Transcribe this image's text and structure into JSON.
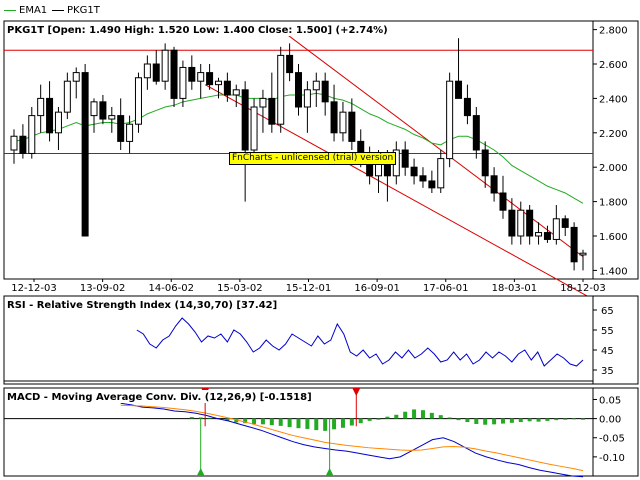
{
  "legend": [
    {
      "label": "EMA1",
      "color": "#22aa22"
    },
    {
      "label": "PKG1T",
      "color": "#000000"
    }
  ],
  "watermark": "FnCharts - unlicensed (trial) version",
  "chart_data": [
    {
      "type": "candlestick",
      "title": "PKG1T [Open: 1.490  High: 1.520  Low: 1.400  Close: 1.500] (+2.74%)",
      "ylim": [
        1.35,
        2.85
      ],
      "yticks": [
        "2.800",
        "2.600",
        "2.400",
        "2.200",
        "2.000",
        "1.800",
        "1.600",
        "1.400"
      ],
      "ytick_values": [
        2.8,
        2.6,
        2.4,
        2.2,
        2.0,
        1.8,
        1.6,
        1.4
      ],
      "xticks": [
        "12-12-03",
        "13-09-02",
        "14-06-02",
        "15-03-02",
        "15-12-01",
        "16-09-01",
        "17-06-01",
        "18-03-01",
        "18-12-03"
      ],
      "horizontal_lines": [
        2.68,
        2.08
      ],
      "candles": [
        {
          "o": 2.1,
          "h": 2.22,
          "l": 2.02,
          "c": 2.18
        },
        {
          "o": 2.18,
          "h": 2.25,
          "l": 2.05,
          "c": 2.08
        },
        {
          "o": 2.08,
          "h": 2.35,
          "l": 2.05,
          "c": 2.3
        },
        {
          "o": 2.3,
          "h": 2.48,
          "l": 2.2,
          "c": 2.4
        },
        {
          "o": 2.4,
          "h": 2.5,
          "l": 2.15,
          "c": 2.2
        },
        {
          "o": 2.2,
          "h": 2.35,
          "l": 2.1,
          "c": 2.32
        },
        {
          "o": 2.32,
          "h": 2.55,
          "l": 2.28,
          "c": 2.5
        },
        {
          "o": 2.5,
          "h": 2.58,
          "l": 2.4,
          "c": 2.55
        },
        {
          "o": 2.55,
          "h": 2.6,
          "l": 1.6,
          "c": 1.6
        },
        {
          "o": 2.3,
          "h": 2.4,
          "l": 2.2,
          "c": 2.38
        },
        {
          "o": 2.38,
          "h": 2.42,
          "l": 2.25,
          "c": 2.28
        },
        {
          "o": 2.28,
          "h": 2.35,
          "l": 2.2,
          "c": 2.3
        },
        {
          "o": 2.3,
          "h": 2.4,
          "l": 2.1,
          "c": 2.15
        },
        {
          "o": 2.15,
          "h": 2.3,
          "l": 2.08,
          "c": 2.25
        },
        {
          "o": 2.25,
          "h": 2.55,
          "l": 2.2,
          "c": 2.52
        },
        {
          "o": 2.52,
          "h": 2.65,
          "l": 2.45,
          "c": 2.6
        },
        {
          "o": 2.6,
          "h": 2.68,
          "l": 2.48,
          "c": 2.5
        },
        {
          "o": 2.5,
          "h": 2.72,
          "l": 2.45,
          "c": 2.68
        },
        {
          "o": 2.68,
          "h": 2.7,
          "l": 2.35,
          "c": 2.4
        },
        {
          "o": 2.4,
          "h": 2.62,
          "l": 2.35,
          "c": 2.58
        },
        {
          "o": 2.58,
          "h": 2.65,
          "l": 2.45,
          "c": 2.5
        },
        {
          "o": 2.5,
          "h": 2.6,
          "l": 2.4,
          "c": 2.55
        },
        {
          "o": 2.55,
          "h": 2.6,
          "l": 2.45,
          "c": 2.48
        },
        {
          "o": 2.48,
          "h": 2.52,
          "l": 2.4,
          "c": 2.5
        },
        {
          "o": 2.5,
          "h": 2.55,
          "l": 2.38,
          "c": 2.42
        },
        {
          "o": 2.42,
          "h": 2.48,
          "l": 2.35,
          "c": 2.45
        },
        {
          "o": 2.45,
          "h": 2.5,
          "l": 1.8,
          "c": 2.1
        },
        {
          "o": 2.1,
          "h": 2.4,
          "l": 2.05,
          "c": 2.35
        },
        {
          "o": 2.35,
          "h": 2.45,
          "l": 2.2,
          "c": 2.4
        },
        {
          "o": 2.4,
          "h": 2.55,
          "l": 2.2,
          "c": 2.25
        },
        {
          "o": 2.25,
          "h": 2.7,
          "l": 2.2,
          "c": 2.65
        },
        {
          "o": 2.65,
          "h": 2.72,
          "l": 2.5,
          "c": 2.55
        },
        {
          "o": 2.55,
          "h": 2.6,
          "l": 2.3,
          "c": 2.35
        },
        {
          "o": 2.35,
          "h": 2.5,
          "l": 2.2,
          "c": 2.45
        },
        {
          "o": 2.45,
          "h": 2.55,
          "l": 2.35,
          "c": 2.5
        },
        {
          "o": 2.5,
          "h": 2.55,
          "l": 2.3,
          "c": 2.38
        },
        {
          "o": 2.38,
          "h": 2.48,
          "l": 2.15,
          "c": 2.2
        },
        {
          "o": 2.2,
          "h": 2.38,
          "l": 2.15,
          "c": 2.32
        },
        {
          "o": 2.32,
          "h": 2.4,
          "l": 2.1,
          "c": 2.15
        },
        {
          "o": 2.15,
          "h": 2.22,
          "l": 2.0,
          "c": 2.05
        },
        {
          "o": 2.05,
          "h": 2.12,
          "l": 1.9,
          "c": 1.95
        },
        {
          "o": 1.95,
          "h": 2.1,
          "l": 1.85,
          "c": 2.05
        },
        {
          "o": 2.05,
          "h": 2.1,
          "l": 1.8,
          "c": 1.95
        },
        {
          "o": 1.95,
          "h": 2.15,
          "l": 1.9,
          "c": 2.1
        },
        {
          "o": 2.1,
          "h": 2.15,
          "l": 1.95,
          "c": 2.0
        },
        {
          "o": 2.0,
          "h": 2.05,
          "l": 1.9,
          "c": 1.95
        },
        {
          "o": 1.95,
          "h": 2.0,
          "l": 1.88,
          "c": 1.92
        },
        {
          "o": 1.92,
          "h": 1.98,
          "l": 1.85,
          "c": 1.88
        },
        {
          "o": 1.88,
          "h": 2.1,
          "l": 1.85,
          "c": 2.05
        },
        {
          "o": 2.05,
          "h": 2.55,
          "l": 2.0,
          "c": 2.5
        },
        {
          "o": 2.5,
          "h": 2.75,
          "l": 2.45,
          "c": 2.4
        },
        {
          "o": 2.4,
          "h": 2.48,
          "l": 2.25,
          "c": 2.3
        },
        {
          "o": 2.3,
          "h": 2.35,
          "l": 2.05,
          "c": 2.1
        },
        {
          "o": 2.1,
          "h": 2.15,
          "l": 1.88,
          "c": 1.95
        },
        {
          "o": 1.95,
          "h": 2.0,
          "l": 1.8,
          "c": 1.85
        },
        {
          "o": 1.85,
          "h": 1.95,
          "l": 1.7,
          "c": 1.75
        },
        {
          "o": 1.75,
          "h": 1.82,
          "l": 1.55,
          "c": 1.6
        },
        {
          "o": 1.6,
          "h": 1.8,
          "l": 1.55,
          "c": 1.75
        },
        {
          "o": 1.75,
          "h": 1.78,
          "l": 1.55,
          "c": 1.6
        },
        {
          "o": 1.6,
          "h": 1.68,
          "l": 1.55,
          "c": 1.62
        },
        {
          "o": 1.62,
          "h": 1.66,
          "l": 1.56,
          "c": 1.58
        },
        {
          "o": 1.58,
          "h": 1.78,
          "l": 1.55,
          "c": 1.7
        },
        {
          "o": 1.7,
          "h": 1.72,
          "l": 1.6,
          "c": 1.65
        },
        {
          "o": 1.65,
          "h": 1.68,
          "l": 1.4,
          "c": 1.45
        },
        {
          "o": 1.49,
          "h": 1.52,
          "l": 1.4,
          "c": 1.5
        }
      ],
      "ema": [
        2.15,
        2.16,
        2.18,
        2.2,
        2.21,
        2.22,
        2.24,
        2.26,
        2.24,
        2.25,
        2.26,
        2.26,
        2.25,
        2.26,
        2.28,
        2.31,
        2.33,
        2.35,
        2.36,
        2.38,
        2.39,
        2.4,
        2.41,
        2.42,
        2.42,
        2.42,
        2.4,
        2.4,
        2.4,
        2.39,
        2.41,
        2.42,
        2.42,
        2.42,
        2.43,
        2.42,
        2.4,
        2.39,
        2.37,
        2.34,
        2.31,
        2.29,
        2.26,
        2.24,
        2.22,
        2.19,
        2.17,
        2.14,
        2.13,
        2.16,
        2.18,
        2.18,
        2.16,
        2.13,
        2.1,
        2.06,
        2.01,
        1.98,
        1.95,
        1.92,
        1.89,
        1.87,
        1.85,
        1.82,
        1.79
      ],
      "trend_channel": {
        "upper": {
          "from": [
            30.5,
            2.78
          ],
          "to": [
            64.0,
            1.48
          ]
        },
        "lower": {
          "from": [
            21.5,
            2.48
          ],
          "to": [
            64.5,
            1.25
          ]
        }
      }
    },
    {
      "type": "line",
      "title": "RSI - Relative Strength Index (14,30,70) [37.42]",
      "ylim": [
        30,
        70
      ],
      "yticks": [
        "65",
        "55",
        "45",
        "35"
      ],
      "ytick_values": [
        65,
        55,
        45,
        35
      ],
      "series": [
        {
          "name": "RSI",
          "color": "#0000cc",
          "values": [
            null,
            null,
            null,
            null,
            null,
            null,
            null,
            null,
            null,
            null,
            null,
            null,
            null,
            null,
            null,
            null,
            null,
            null,
            null,
            55,
            53,
            48,
            46,
            50,
            52,
            57,
            61,
            58,
            54,
            49,
            52,
            51,
            53,
            49,
            55,
            53,
            49,
            44,
            46,
            50,
            47,
            45,
            48,
            53,
            51,
            49,
            47,
            52,
            48,
            50,
            58,
            53,
            44,
            42,
            45,
            41,
            43,
            38,
            40,
            44,
            41,
            45,
            41,
            43,
            46,
            43,
            39,
            40,
            44,
            40,
            43,
            38,
            40,
            44,
            41,
            44,
            42,
            39,
            43,
            45,
            40,
            44,
            37,
            40,
            43,
            41,
            38,
            37,
            40
          ]
        }
      ]
    },
    {
      "type": "bar+line",
      "title": "MACD - Moving Average Conv. Div. (12,26,9) [-0.1518]",
      "ylim": [
        -0.15,
        0.08
      ],
      "yticks": [
        "0.05",
        "0.00",
        "-0.05",
        "-0.10"
      ],
      "ytick_values": [
        0.05,
        0.0,
        -0.05,
        -0.1
      ],
      "histogram": [
        0.0,
        0.0,
        0.0,
        0.0,
        0.0,
        0.0,
        0.0,
        0.0,
        0.0,
        0.0,
        0.0,
        0.0,
        0.0,
        0.0,
        0.0,
        0.0,
        0.0,
        0.0,
        0.0,
        0.0,
        0.004,
        0.003,
        0.002,
        -0.001,
        -0.006,
        -0.01,
        -0.012,
        -0.014,
        -0.015,
        -0.017,
        -0.019,
        -0.022,
        -0.025,
        -0.027,
        -0.03,
        -0.032,
        -0.028,
        -0.024,
        -0.018,
        -0.012,
        -0.006,
        -0.003,
        0.005,
        0.01,
        0.018,
        0.024,
        0.022,
        0.015,
        0.009,
        0.003,
        -0.004,
        -0.009,
        -0.014,
        -0.016,
        -0.015,
        -0.013,
        -0.011,
        -0.009,
        -0.007,
        -0.008,
        -0.006,
        -0.004,
        -0.003,
        -0.002,
        -0.003
      ],
      "series": [
        {
          "name": "MACD",
          "color": "#0000cc",
          "values": [
            0.04,
            0.036,
            0.03,
            0.028,
            0.025,
            0.02,
            0.018,
            0.014,
            0.008,
            0.0,
            -0.006,
            -0.014,
            -0.022,
            -0.03,
            -0.04,
            -0.05,
            -0.06,
            -0.068,
            -0.074,
            -0.078,
            -0.082,
            -0.085,
            -0.09,
            -0.095,
            -0.1,
            -0.105,
            -0.1,
            -0.085,
            -0.07,
            -0.055,
            -0.05,
            -0.06,
            -0.075,
            -0.09,
            -0.1,
            -0.108,
            -0.115,
            -0.12,
            -0.128,
            -0.135,
            -0.14,
            -0.145,
            -0.15,
            -0.152
          ]
        },
        {
          "name": "Signal",
          "color": "#ff8800",
          "values": [
            0.035,
            0.034,
            0.033,
            0.031,
            0.029,
            0.026,
            0.023,
            0.019,
            0.014,
            0.008,
            0.002,
            -0.005,
            -0.012,
            -0.02,
            -0.028,
            -0.036,
            -0.044,
            -0.05,
            -0.056,
            -0.062,
            -0.066,
            -0.07,
            -0.073,
            -0.076,
            -0.078,
            -0.08,
            -0.082,
            -0.083,
            -0.082,
            -0.078,
            -0.074,
            -0.073,
            -0.075,
            -0.079,
            -0.085,
            -0.09,
            -0.096,
            -0.102,
            -0.108,
            -0.114,
            -0.12,
            -0.125,
            -0.13,
            -0.136
          ]
        }
      ],
      "macd_x_start": 12
    }
  ]
}
